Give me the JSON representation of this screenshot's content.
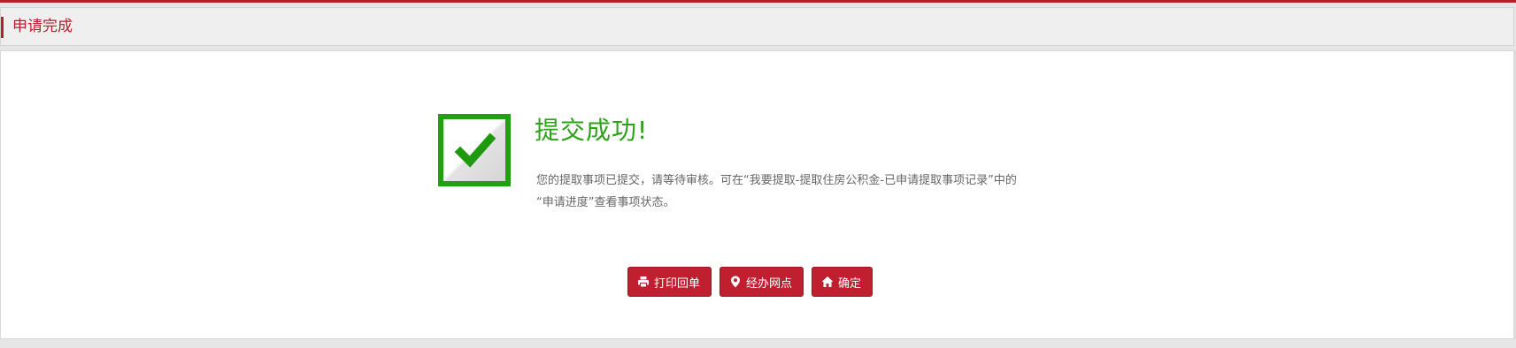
{
  "header": {
    "title": "申请完成"
  },
  "result": {
    "icon": "check-icon",
    "title": "提交成功!",
    "message_line1": "您的提取事项已提交，请等待审核。可在“我要提取-提取住房公积金-已申请提取事项记录”中的",
    "message_line2": "“申请进度”查看事项状态。",
    "accent_color": "#2aa317"
  },
  "actions": {
    "print_label": "打印回单",
    "print_icon": "printer-icon",
    "outlets_label": "经办网点",
    "outlets_icon": "map-pin-icon",
    "confirm_label": "确定",
    "confirm_icon": "home-icon",
    "button_color": "#bf1f2f"
  },
  "theme": {
    "brand_color": "#b5202e"
  }
}
